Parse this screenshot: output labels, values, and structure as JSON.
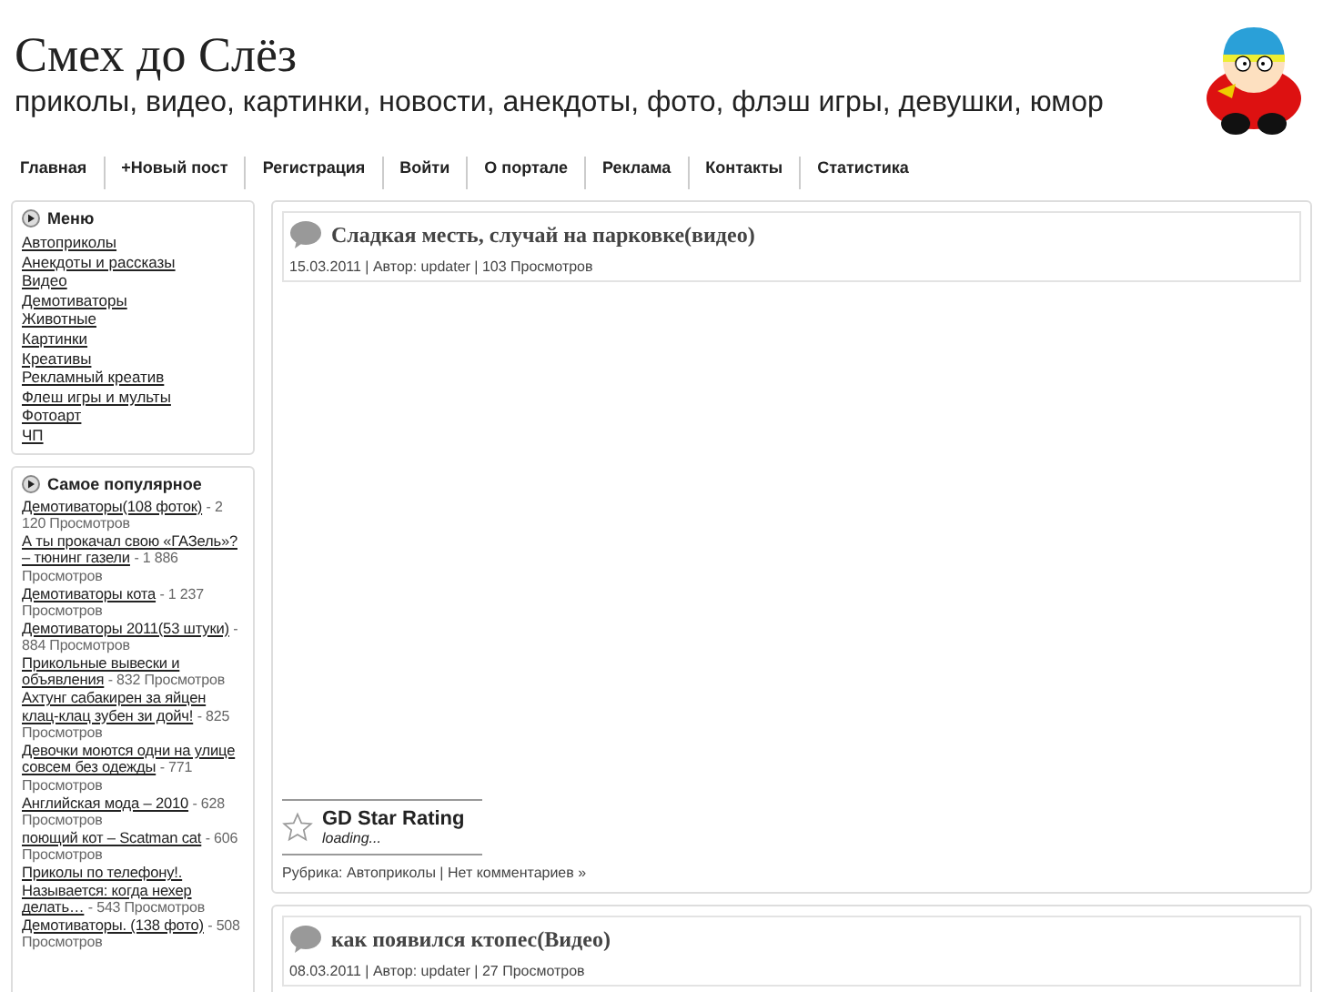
{
  "site": {
    "title": "Смех до Слёз",
    "tagline": "приколы, видео, картинки, новости, анекдоты, фото, флэш игры, девушки, юмор"
  },
  "nav": [
    "Главная",
    "+Новый пост",
    "Регистрация",
    "Войти",
    "О портале",
    "Реклама",
    "Контакты",
    "Статистика"
  ],
  "menu": {
    "title": "Меню",
    "items": [
      "Автоприколы",
      "Анекдоты и рассказы",
      "Видео",
      "Демотиваторы",
      "Животные",
      "Картинки",
      "Креативы",
      "Рекламный креатив",
      "Флеш игры и мульты",
      "Фотоарт",
      "ЧП"
    ]
  },
  "popular": {
    "title": "Самое популярное",
    "items": [
      {
        "title": "Демотиваторы(108 фоток)",
        "views": "- 2 120 Просмотров"
      },
      {
        "title": "А ты прокачал свою «ГАЗель»? – тюнинг газели",
        "views": "- 1 886 Просмотров"
      },
      {
        "title": "Демотиваторы кота",
        "views": "- 1 237 Просмотров"
      },
      {
        "title": "Демотиваторы 2011(53 штуки)",
        "views": "- 884 Просмотров"
      },
      {
        "title": "Прикольные вывески и объявления",
        "views": "- 832 Просмотров"
      },
      {
        "title": "Ахтунг сабакирен за яйцен клац-клац зубен зи дойч!",
        "views": "- 825 Просмотров"
      },
      {
        "title": "Девочки моются одни на улице совсем без одежды",
        "views": "- 771 Просмотров"
      },
      {
        "title": "Английская мода – 2010",
        "views": "- 628 Просмотров"
      },
      {
        "title": "поющий кот – Scatman cat",
        "views": "- 606 Просмотров"
      },
      {
        "title": "Приколы по телефону!. Называется: когда нехер делать…",
        "views": "- 543 Просмотров"
      },
      {
        "title": "Демотиваторы. (138 фото)",
        "views": "- 508 Просмотров"
      }
    ]
  },
  "posts": [
    {
      "title": "Сладкая месть, случай на парковке(видео)",
      "meta": "15.03.2011 | Автор: updater | 103 Просмотров",
      "rating": {
        "title": "GD Star Rating",
        "status": "loading..."
      },
      "footer": "Рубрика: Автоприколы | Нет комментариев »"
    },
    {
      "title": "как появился ктопес(Видео)",
      "meta": "08.03.2011 | Автор: updater | 27 Просмотров"
    }
  ]
}
